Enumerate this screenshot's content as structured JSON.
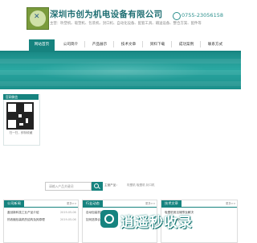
{
  "header": {
    "company_name": "深圳市创为机电设备有限公司",
    "subtitle": "主营：吹塑机、吸塑机、包装机、封口机、自动化设备、配套工具、输送设备、整合方案、配件等",
    "phone": "0755-23056158"
  },
  "nav": {
    "items": [
      {
        "label": "网站首页",
        "active": true
      },
      {
        "label": "公司简介",
        "active": false
      },
      {
        "label": "产品展示",
        "active": false
      },
      {
        "label": "技术文章",
        "active": false
      },
      {
        "label": "资料下载",
        "active": false
      },
      {
        "label": "成功案例",
        "active": false
      },
      {
        "label": "联系方式",
        "active": false
      }
    ]
  },
  "wechat": {
    "title": "官网微信",
    "caption": "扫一扫，即刻收藏"
  },
  "search": {
    "placeholder": "请输入产品关键词",
    "label": "主营产品：",
    "links": "吹塑机  吸塑机  封口机"
  },
  "panels": {
    "left": {
      "title": "公司新闻",
      "more": "更多>>",
      "rows": [
        {
          "text": "盖创新科技工业产品介绍",
          "date": "2019-05-06"
        },
        {
          "text": "热收缩包装机的结构及其原理",
          "date": "2019-05-06"
        }
      ]
    },
    "middle": {
      "title": "行业动态",
      "more": "更多>>",
      "rows": [
        {
          "text": "自动包装机的使用说明",
          "date": ""
        },
        {
          "text": "如何选择合适的包装设备",
          "date": ""
        }
      ]
    },
    "right": {
      "title": "技术文章",
      "more": "更多>>",
      "rows": [
        {
          "text": "吸塑机常见故障及解决",
          "date": ""
        },
        {
          "text": "封口机日常维护保养",
          "date": ""
        }
      ]
    }
  },
  "watermark": "逍遥秒收录",
  "colors": {
    "accent": "#16837f",
    "title_text": "#1f6f73"
  }
}
